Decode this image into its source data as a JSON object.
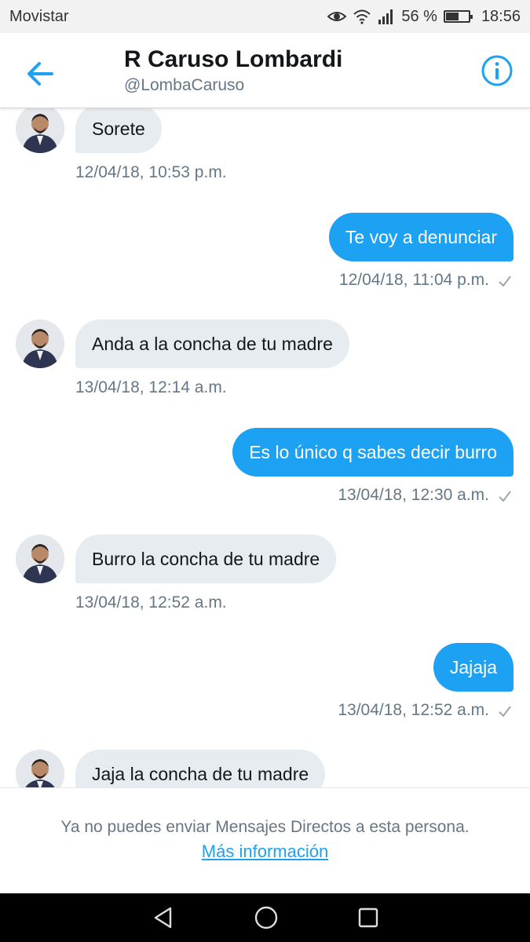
{
  "status_bar": {
    "carrier": "Movistar",
    "battery_text": "56 %",
    "battery_level": 0.56,
    "time": "18:56"
  },
  "header": {
    "title": "R Caruso Lombardi",
    "handle": "@LombaCaruso"
  },
  "messages": [
    {
      "direction": "in",
      "text": "Sorete",
      "time": "12/04/18, 10:53 p.m."
    },
    {
      "direction": "out",
      "text": "Te voy a denunciar",
      "time": "12/04/18, 11:04 p.m."
    },
    {
      "direction": "in",
      "text": "Anda a la concha de tu madre",
      "time": "13/04/18, 12:14 a.m."
    },
    {
      "direction": "out",
      "text": "Es lo único q sabes decir burro",
      "time": "13/04/18, 12:30 a.m."
    },
    {
      "direction": "in",
      "text": "Burro la concha de tu madre",
      "time": "13/04/18, 12:52 a.m."
    },
    {
      "direction": "out",
      "text": "Jajaja",
      "time": "13/04/18, 12:52 a.m."
    },
    {
      "direction": "in",
      "text": "Jaja la concha de tu madre",
      "time": ""
    }
  ],
  "footer": {
    "notice": "Ya no puedes enviar Mensajes Directos a esta persona.",
    "link": "Más información"
  },
  "colors": {
    "accent": "#1da1f2",
    "incoming_bubble": "#e6ecf0",
    "muted_text": "#657786"
  },
  "icons": {
    "back": "arrow-left-icon",
    "info": "info-circle-icon",
    "read_receipt": "check-icon",
    "nav": [
      "back-triangle-icon",
      "home-circle-icon",
      "recents-square-icon"
    ]
  }
}
